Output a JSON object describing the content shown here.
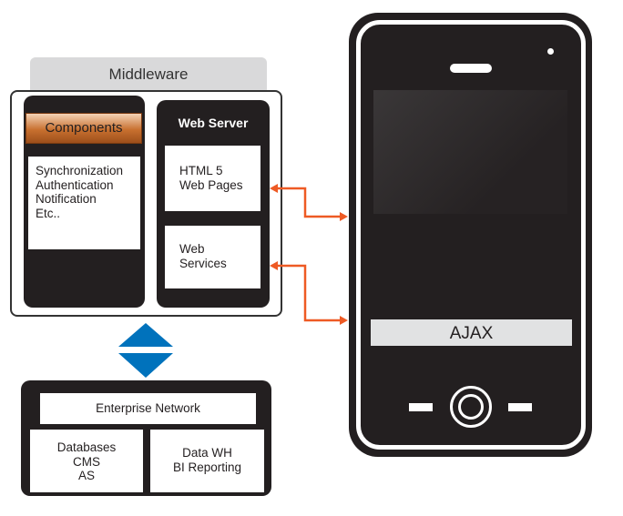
{
  "middleware": {
    "title": "Middleware",
    "components": {
      "title": "Components",
      "items": [
        "Synchronization",
        "Authentication",
        "Notification",
        "Etc.."
      ]
    },
    "web_server": {
      "title": "Web Server",
      "html5": [
        "HTML 5",
        "Web Pages"
      ],
      "web_services": [
        "Web",
        "Services"
      ]
    }
  },
  "enterprise": {
    "title": "Enterprise Network",
    "left": [
      "Databases",
      "CMS",
      "AS"
    ],
    "right": [
      "Data WH",
      "BI Reporting"
    ]
  },
  "phone": {
    "label": "AJAX"
  },
  "colors": {
    "arrow": "#ee5a24",
    "connector": "#0072bc",
    "components": "#c8702f",
    "dark": "#231f20"
  }
}
